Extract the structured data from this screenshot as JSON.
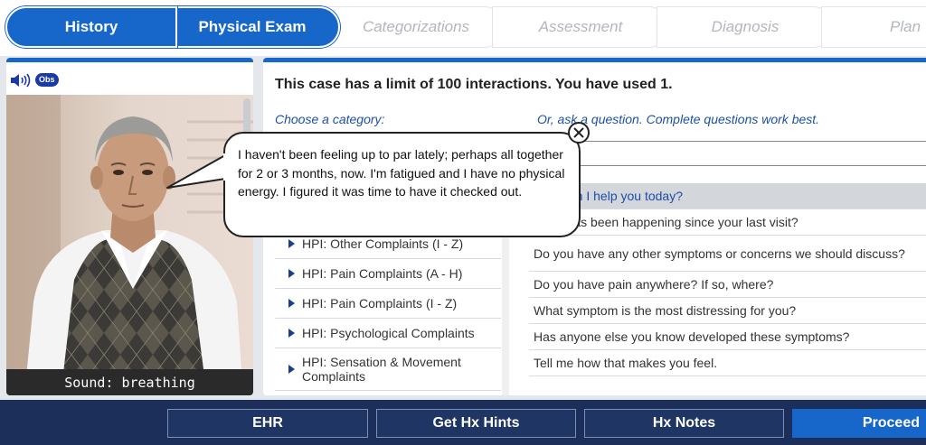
{
  "tabs": [
    {
      "label": "History",
      "state": "active"
    },
    {
      "label": "Physical Exam",
      "state": "active"
    },
    {
      "label": "Categorizations",
      "state": "disabled"
    },
    {
      "label": "Assessment",
      "state": "disabled"
    },
    {
      "label": "Diagnosis",
      "state": "disabled"
    },
    {
      "label": "Plan",
      "state": "disabled"
    }
  ],
  "patient": {
    "obs_label": "Obs",
    "sound_caption": "Sound: breathing",
    "speaker_icon": "speaker-icon"
  },
  "main": {
    "limit_text": "This case has a limit of 100 interactions. You have used 1.",
    "choose_label": "Choose a category:",
    "ask_label": "Or, ask a question. Complete questions work best.",
    "question_input_value": "",
    "categories": [
      "HPI: Other Complaints (I - Z)",
      "HPI: Pain Complaints (A - H)",
      "HPI: Pain Complaints (I - Z)",
      "HPI: Psychological Complaints",
      "HPI: Sensation & Movement Complaints"
    ],
    "questions": [
      "How can I help you today?",
      "What has been happening since your last visit?",
      "Do you have any other symptoms or concerns we should discuss?",
      "Do you have pain anywhere? If so, where?",
      "What symptom is the most distressing for you?",
      "Has anyone else you know developed these symptoms?",
      "Tell me how that makes you feel."
    ]
  },
  "speech_bubble": {
    "text": "I haven't been feeling up to par lately; perhaps all together for 2 or 3 months, now. I'm fatigued and I have no physical energy. I figured it was time to have it checked out."
  },
  "footer": {
    "ehr": "EHR",
    "hints": "Get Hx Hints",
    "notes": "Hx Notes",
    "proceed": "Proceed"
  },
  "colors": {
    "accent": "#1766c9",
    "footer_bg": "#1b2f5a",
    "link_text": "#1b4fa8"
  }
}
